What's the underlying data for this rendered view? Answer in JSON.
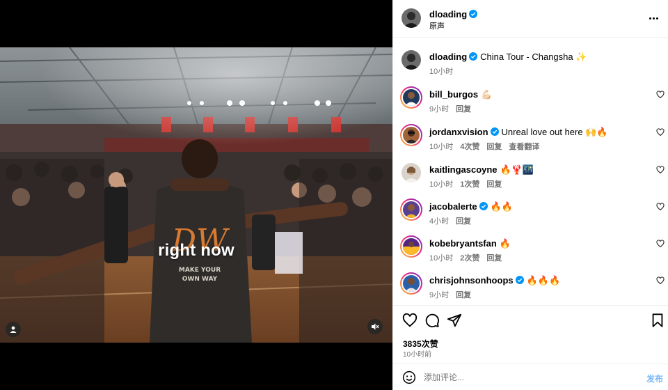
{
  "post": {
    "author": "dloading",
    "audio": "原声",
    "caption": {
      "username": "dloading",
      "text": "China Tour - Changsha ✨",
      "time": "10小时"
    },
    "video_overlay_text": "right now",
    "likes": "3835次赞",
    "posted": "10小时前"
  },
  "comments": [
    {
      "username": "bill_burgos",
      "verified": false,
      "text": "💪🏻",
      "time": "9小时",
      "likes": "",
      "reply": "回复",
      "translate": ""
    },
    {
      "username": "jordanxvision",
      "verified": true,
      "text": "Unreal love out here 🙌🔥",
      "time": "10小时",
      "likes": "4次赞",
      "reply": "回复",
      "translate": "查看翻译"
    },
    {
      "username": "kaitlingascoyne",
      "verified": false,
      "text": "🔥🦞🌃",
      "time": "10小时",
      "likes": "1次赞",
      "reply": "回复",
      "translate": ""
    },
    {
      "username": "jacobalerte",
      "verified": true,
      "text": "🔥🔥",
      "time": "4小时",
      "likes": "",
      "reply": "回复",
      "translate": ""
    },
    {
      "username": "kobebryantsfan",
      "verified": false,
      "text": "🔥",
      "time": "10小时",
      "likes": "2次赞",
      "reply": "回复",
      "translate": ""
    },
    {
      "username": "chrisjohnsonhoops",
      "verified": true,
      "text": "🔥🔥🔥",
      "time": "9小时",
      "likes": "",
      "reply": "回复",
      "translate": ""
    }
  ],
  "composer": {
    "placeholder": "添加评论...",
    "post_label": "发布"
  },
  "icons": {
    "more": "more-horizontal-icon",
    "like": "heart-icon",
    "comment": "comment-bubble-icon",
    "share": "paper-plane-icon",
    "save": "bookmark-icon",
    "emoji": "smiley-icon",
    "mute": "speaker-muted-icon",
    "tag": "user-tag-icon"
  },
  "colors": {
    "verified": "#0095f6",
    "post_button": "#7fb8f5",
    "secondary_text": "#737373"
  }
}
